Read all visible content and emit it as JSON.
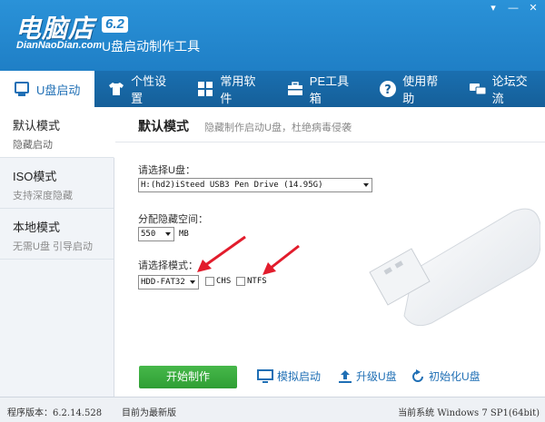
{
  "app": {
    "logo_text": "电脑店",
    "version": "6.2",
    "domain": "DianNaoDian.com",
    "subtitle": "U盘启动制作工具"
  },
  "window_controls": [
    "▾",
    "—",
    "✕"
  ],
  "nav": {
    "items": [
      {
        "label": "U盘启动",
        "icon": "usb-icon",
        "active": true
      },
      {
        "label": "个性设置",
        "icon": "shirt-icon",
        "active": false
      },
      {
        "label": "常用软件",
        "icon": "apps-icon",
        "active": false
      },
      {
        "label": "PE工具箱",
        "icon": "toolbox-icon",
        "active": false
      },
      {
        "label": "使用帮助",
        "icon": "help-icon",
        "active": false
      },
      {
        "label": "论坛交流",
        "icon": "chat-icon",
        "active": false
      }
    ]
  },
  "sidebar": {
    "items": [
      {
        "title": "默认模式",
        "desc": "隐藏启动",
        "active": true
      },
      {
        "title": "ISO模式",
        "desc": "支持深度隐藏",
        "active": false
      },
      {
        "title": "本地模式",
        "desc": "无需U盘 引导启动",
        "active": false
      }
    ]
  },
  "main": {
    "title": "默认模式",
    "desc": "隐藏制作启动U盘，杜绝病毒侵袭",
    "select_disk_label": "请选择U盘：",
    "select_disk_value": "H:(hd2)iSteed USB3 Pen Drive (14.95G)",
    "hidden_space_label": "分配隐藏空间：",
    "hidden_space_value": "550",
    "hidden_space_unit": "MB",
    "mode_label": "请选择模式：",
    "mode_value": "HDD-FAT32",
    "chs_label": "CHS",
    "ntfs_label": "NTFS"
  },
  "actions": {
    "start": "开始制作",
    "simulate": "模拟启动",
    "upgrade": "升级U盘",
    "init": "初始化U盘"
  },
  "status": {
    "version": "程序版本：6.2.14.528",
    "latest": "目前为最新版",
    "system": "当前系统 Windows 7 SP1(64bit)"
  },
  "colors": {
    "header_blue": "#1f7fc6",
    "nav_blue": "#155f99",
    "start_green": "#3aab3e",
    "arrow_red": "#e21c2c"
  }
}
